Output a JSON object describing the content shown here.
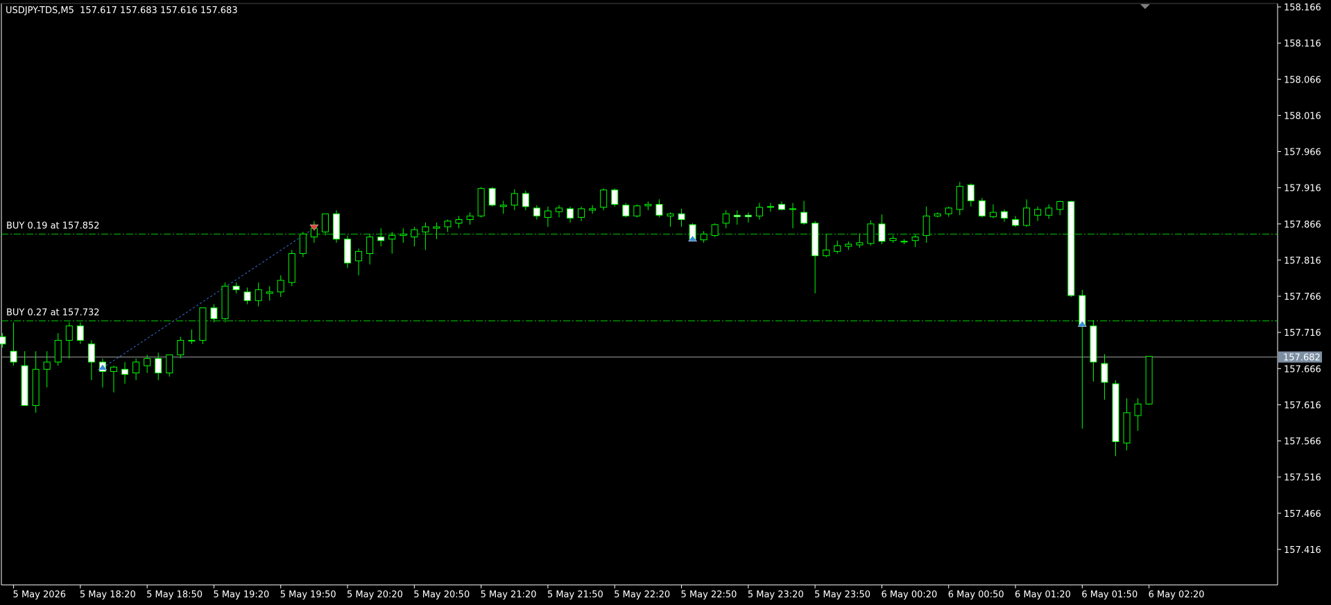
{
  "header": {
    "symbol_timeframe": "USDJPY-TDS,M5",
    "ohlc": "157.617 157.683 157.616 157.683"
  },
  "colors": {
    "background": "#000000",
    "axis": "#ffffff",
    "bull_body": "#000000",
    "bear_body": "#ffffff",
    "candle_outline": "#00ff00",
    "wick": "#00ff00",
    "position_line": "#00cc00",
    "bid_line": "#a0a0a0",
    "price_tag_bg": "#7d8fa3",
    "trade_connector": "#3a6fd8",
    "sell_marker": "#e0452f",
    "buy_marker": "#3a8ad8"
  },
  "chart_data": {
    "type": "candlestick",
    "timeframe": "M5",
    "ylim": [
      157.366,
      158.166
    ],
    "y_ticks": [
      "158.166",
      "158.116",
      "158.066",
      "158.016",
      "157.966",
      "157.916",
      "157.866",
      "157.816",
      "157.766",
      "157.716",
      "157.666",
      "157.616",
      "157.566",
      "157.516",
      "157.466",
      "157.416"
    ],
    "x_ticks": [
      {
        "label": "5 May 2026",
        "index": 1
      },
      {
        "label": "5 May 18:20",
        "index": 7
      },
      {
        "label": "5 May 18:50",
        "index": 13
      },
      {
        "label": "5 May 19:20",
        "index": 19
      },
      {
        "label": "5 May 19:50",
        "index": 25
      },
      {
        "label": "5 May 20:20",
        "index": 31
      },
      {
        "label": "5 May 20:50",
        "index": 37
      },
      {
        "label": "5 May 21:20",
        "index": 43
      },
      {
        "label": "5 May 21:50",
        "index": 49
      },
      {
        "label": "5 May 22:20",
        "index": 55
      },
      {
        "label": "5 May 22:50",
        "index": 61
      },
      {
        "label": "5 May 23:20",
        "index": 67
      },
      {
        "label": "5 May 23:50",
        "index": 73
      },
      {
        "label": "6 May 00:20",
        "index": 79
      },
      {
        "label": "6 May 00:50",
        "index": 85
      },
      {
        "label": "6 May 01:20",
        "index": 91
      },
      {
        "label": "6 May 01:50",
        "index": 97
      },
      {
        "label": "6 May 02:20",
        "index": 103
      }
    ],
    "candles": [
      {
        "o": 157.71,
        "h": 157.715,
        "l": 157.695,
        "c": 157.7
      },
      {
        "o": 157.69,
        "h": 157.73,
        "l": 157.67,
        "c": 157.675
      },
      {
        "o": 157.67,
        "h": 157.69,
        "l": 157.62,
        "c": 157.615
      },
      {
        "o": 157.615,
        "h": 157.69,
        "l": 157.605,
        "c": 157.665
      },
      {
        "o": 157.665,
        "h": 157.69,
        "l": 157.64,
        "c": 157.675
      },
      {
        "o": 157.675,
        "h": 157.715,
        "l": 157.67,
        "c": 157.705
      },
      {
        "o": 157.705,
        "h": 157.73,
        "l": 157.68,
        "c": 157.725
      },
      {
        "o": 157.725,
        "h": 157.73,
        "l": 157.7,
        "c": 157.705
      },
      {
        "o": 157.7,
        "h": 157.705,
        "l": 157.65,
        "c": 157.675
      },
      {
        "o": 157.675,
        "h": 157.68,
        "l": 157.64,
        "c": 157.662
      },
      {
        "o": 157.662,
        "h": 157.67,
        "l": 157.633,
        "c": 157.668
      },
      {
        "o": 157.665,
        "h": 157.675,
        "l": 157.645,
        "c": 157.658
      },
      {
        "o": 157.66,
        "h": 157.68,
        "l": 157.65,
        "c": 157.675
      },
      {
        "o": 157.67,
        "h": 157.685,
        "l": 157.66,
        "c": 157.68
      },
      {
        "o": 157.68,
        "h": 157.688,
        "l": 157.65,
        "c": 157.66
      },
      {
        "o": 157.66,
        "h": 157.685,
        "l": 157.655,
        "c": 157.685
      },
      {
        "o": 157.685,
        "h": 157.71,
        "l": 157.68,
        "c": 157.705
      },
      {
        "o": 157.705,
        "h": 157.72,
        "l": 157.7,
        "c": 157.705
      },
      {
        "o": 157.705,
        "h": 157.75,
        "l": 157.7,
        "c": 157.75
      },
      {
        "o": 157.75,
        "h": 157.755,
        "l": 157.73,
        "c": 157.735
      },
      {
        "o": 157.735,
        "h": 157.785,
        "l": 157.73,
        "c": 157.78
      },
      {
        "o": 157.78,
        "h": 157.785,
        "l": 157.77,
        "c": 157.775
      },
      {
        "o": 157.772,
        "h": 157.778,
        "l": 157.755,
        "c": 157.76
      },
      {
        "o": 157.76,
        "h": 157.785,
        "l": 157.752,
        "c": 157.775
      },
      {
        "o": 157.77,
        "h": 157.78,
        "l": 157.76,
        "c": 157.772
      },
      {
        "o": 157.772,
        "h": 157.795,
        "l": 157.765,
        "c": 157.788
      },
      {
        "o": 157.785,
        "h": 157.83,
        "l": 157.78,
        "c": 157.825
      },
      {
        "o": 157.825,
        "h": 157.855,
        "l": 157.82,
        "c": 157.852
      },
      {
        "o": 157.848,
        "h": 157.87,
        "l": 157.84,
        "c": 157.86
      },
      {
        "o": 157.855,
        "h": 157.88,
        "l": 157.85,
        "c": 157.88
      },
      {
        "o": 157.88,
        "h": 157.885,
        "l": 157.84,
        "c": 157.845
      },
      {
        "o": 157.845,
        "h": 157.85,
        "l": 157.805,
        "c": 157.812
      },
      {
        "o": 157.815,
        "h": 157.832,
        "l": 157.795,
        "c": 157.828
      },
      {
        "o": 157.825,
        "h": 157.852,
        "l": 157.81,
        "c": 157.848
      },
      {
        "o": 157.848,
        "h": 157.86,
        "l": 157.835,
        "c": 157.843
      },
      {
        "o": 157.845,
        "h": 157.855,
        "l": 157.825,
        "c": 157.85
      },
      {
        "o": 157.85,
        "h": 157.86,
        "l": 157.84,
        "c": 157.852
      },
      {
        "o": 157.848,
        "h": 157.862,
        "l": 157.835,
        "c": 157.858
      },
      {
        "o": 157.855,
        "h": 157.868,
        "l": 157.83,
        "c": 157.862
      },
      {
        "o": 157.86,
        "h": 157.868,
        "l": 157.845,
        "c": 157.862
      },
      {
        "o": 157.862,
        "h": 157.872,
        "l": 157.855,
        "c": 157.87
      },
      {
        "o": 157.867,
        "h": 157.877,
        "l": 157.86,
        "c": 157.872
      },
      {
        "o": 157.872,
        "h": 157.882,
        "l": 157.865,
        "c": 157.877
      },
      {
        "o": 157.877,
        "h": 157.917,
        "l": 157.875,
        "c": 157.915
      },
      {
        "o": 157.915,
        "h": 157.917,
        "l": 157.89,
        "c": 157.892
      },
      {
        "o": 157.89,
        "h": 157.898,
        "l": 157.88,
        "c": 157.892
      },
      {
        "o": 157.892,
        "h": 157.914,
        "l": 157.885,
        "c": 157.908
      },
      {
        "o": 157.908,
        "h": 157.912,
        "l": 157.885,
        "c": 157.89
      },
      {
        "o": 157.888,
        "h": 157.892,
        "l": 157.872,
        "c": 157.877
      },
      {
        "o": 157.875,
        "h": 157.89,
        "l": 157.862,
        "c": 157.884
      },
      {
        "o": 157.883,
        "h": 157.892,
        "l": 157.875,
        "c": 157.888
      },
      {
        "o": 157.887,
        "h": 157.89,
        "l": 157.868,
        "c": 157.874
      },
      {
        "o": 157.875,
        "h": 157.89,
        "l": 157.87,
        "c": 157.887
      },
      {
        "o": 157.885,
        "h": 157.892,
        "l": 157.88,
        "c": 157.887
      },
      {
        "o": 157.889,
        "h": 157.915,
        "l": 157.885,
        "c": 157.913
      },
      {
        "o": 157.913,
        "h": 157.915,
        "l": 157.89,
        "c": 157.893
      },
      {
        "o": 157.892,
        "h": 157.895,
        "l": 157.875,
        "c": 157.877
      },
      {
        "o": 157.877,
        "h": 157.893,
        "l": 157.875,
        "c": 157.891
      },
      {
        "o": 157.891,
        "h": 157.897,
        "l": 157.885,
        "c": 157.893
      },
      {
        "o": 157.893,
        "h": 157.9,
        "l": 157.875,
        "c": 157.878
      },
      {
        "o": 157.877,
        "h": 157.882,
        "l": 157.862,
        "c": 157.88
      },
      {
        "o": 157.88,
        "h": 157.887,
        "l": 157.862,
        "c": 157.872
      },
      {
        "o": 157.865,
        "h": 157.867,
        "l": 157.845,
        "c": 157.845
      },
      {
        "o": 157.844,
        "h": 157.856,
        "l": 157.84,
        "c": 157.852
      },
      {
        "o": 157.85,
        "h": 157.867,
        "l": 157.848,
        "c": 157.865
      },
      {
        "o": 157.867,
        "h": 157.885,
        "l": 157.86,
        "c": 157.88
      },
      {
        "o": 157.878,
        "h": 157.885,
        "l": 157.865,
        "c": 157.876
      },
      {
        "o": 157.878,
        "h": 157.882,
        "l": 157.868,
        "c": 157.876
      },
      {
        "o": 157.877,
        "h": 157.895,
        "l": 157.872,
        "c": 157.889
      },
      {
        "o": 157.889,
        "h": 157.895,
        "l": 157.883,
        "c": 157.89
      },
      {
        "o": 157.893,
        "h": 157.897,
        "l": 157.885,
        "c": 157.886
      },
      {
        "o": 157.886,
        "h": 157.895,
        "l": 157.86,
        "c": 157.887
      },
      {
        "o": 157.882,
        "h": 157.898,
        "l": 157.865,
        "c": 157.867
      },
      {
        "o": 157.867,
        "h": 157.87,
        "l": 157.77,
        "c": 157.822
      },
      {
        "o": 157.822,
        "h": 157.852,
        "l": 157.82,
        "c": 157.83
      },
      {
        "o": 157.828,
        "h": 157.843,
        "l": 157.825,
        "c": 157.836
      },
      {
        "o": 157.835,
        "h": 157.842,
        "l": 157.83,
        "c": 157.838
      },
      {
        "o": 157.837,
        "h": 157.853,
        "l": 157.833,
        "c": 157.84
      },
      {
        "o": 157.839,
        "h": 157.871,
        "l": 157.836,
        "c": 157.866
      },
      {
        "o": 157.866,
        "h": 157.879,
        "l": 157.838,
        "c": 157.842
      },
      {
        "o": 157.843,
        "h": 157.85,
        "l": 157.84,
        "c": 157.846
      },
      {
        "o": 157.841,
        "h": 157.845,
        "l": 157.838,
        "c": 157.842
      },
      {
        "o": 157.843,
        "h": 157.851,
        "l": 157.834,
        "c": 157.848
      },
      {
        "o": 157.85,
        "h": 157.89,
        "l": 157.84,
        "c": 157.877
      },
      {
        "o": 157.877,
        "h": 157.882,
        "l": 157.875,
        "c": 157.88
      },
      {
        "o": 157.88,
        "h": 157.89,
        "l": 157.876,
        "c": 157.888
      },
      {
        "o": 157.886,
        "h": 157.924,
        "l": 157.878,
        "c": 157.918
      },
      {
        "o": 157.92,
        "h": 157.922,
        "l": 157.89,
        "c": 157.898
      },
      {
        "o": 157.898,
        "h": 157.902,
        "l": 157.875,
        "c": 157.877
      },
      {
        "o": 157.876,
        "h": 157.893,
        "l": 157.874,
        "c": 157.882
      },
      {
        "o": 157.883,
        "h": 157.886,
        "l": 157.869,
        "c": 157.874
      },
      {
        "o": 157.872,
        "h": 157.877,
        "l": 157.862,
        "c": 157.864
      },
      {
        "o": 157.864,
        "h": 157.9,
        "l": 157.862,
        "c": 157.888
      },
      {
        "o": 157.878,
        "h": 157.89,
        "l": 157.87,
        "c": 157.886
      },
      {
        "o": 157.878,
        "h": 157.893,
        "l": 157.873,
        "c": 157.888
      },
      {
        "o": 157.886,
        "h": 157.898,
        "l": 157.878,
        "c": 157.897
      },
      {
        "o": 157.897,
        "h": 157.898,
        "l": 157.765,
        "c": 157.767
      },
      {
        "o": 157.767,
        "h": 157.775,
        "l": 157.583,
        "c": 157.725
      },
      {
        "o": 157.725,
        "h": 157.733,
        "l": 157.648,
        "c": 157.675
      },
      {
        "o": 157.673,
        "h": 157.686,
        "l": 157.623,
        "c": 157.647
      },
      {
        "o": 157.645,
        "h": 157.65,
        "l": 157.545,
        "c": 157.565
      },
      {
        "o": 157.563,
        "h": 157.625,
        "l": 157.553,
        "c": 157.605
      },
      {
        "o": 157.601,
        "h": 157.625,
        "l": 157.58,
        "c": 157.617
      },
      {
        "o": 157.617,
        "h": 157.683,
        "l": 157.616,
        "c": 157.683
      }
    ],
    "position_lines": [
      {
        "label": "BUY 0.19 at 157.852",
        "price": 157.852
      },
      {
        "label": "BUY 0.27 at 157.732",
        "price": 157.732
      }
    ],
    "bid_price": 157.682,
    "bid_label": "157.682",
    "trade_markers": [
      {
        "type": "buy",
        "index": 9,
        "price": 157.667
      },
      {
        "type": "sell",
        "index": 28,
        "price": 157.86
      },
      {
        "type": "buy",
        "index": 62,
        "price": 157.845
      },
      {
        "type": "buy",
        "index": 97,
        "price": 157.727
      }
    ],
    "trade_connectors": [
      {
        "from": {
          "index": 9,
          "price": 157.667
        },
        "to": {
          "index": 28,
          "price": 157.86
        }
      }
    ]
  }
}
